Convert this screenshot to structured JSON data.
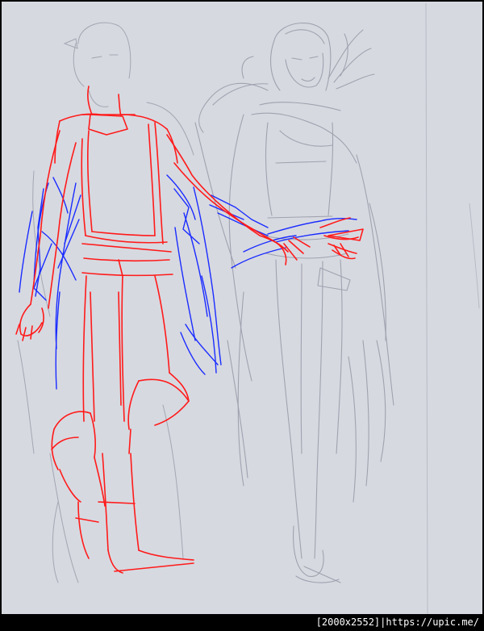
{
  "image": {
    "kind": "pencil-sketch",
    "subject": "two-standing-figures",
    "colors": {
      "paper": "#d7d9e0",
      "pencil": "#9a9caa",
      "red_overlay": "#ff1a1a",
      "blue_overlay": "#1a2cff",
      "frame": "#000000"
    }
  },
  "watermark": {
    "resolution": "[2000x2552]",
    "separator": "|",
    "url": "https://upic.me/"
  }
}
